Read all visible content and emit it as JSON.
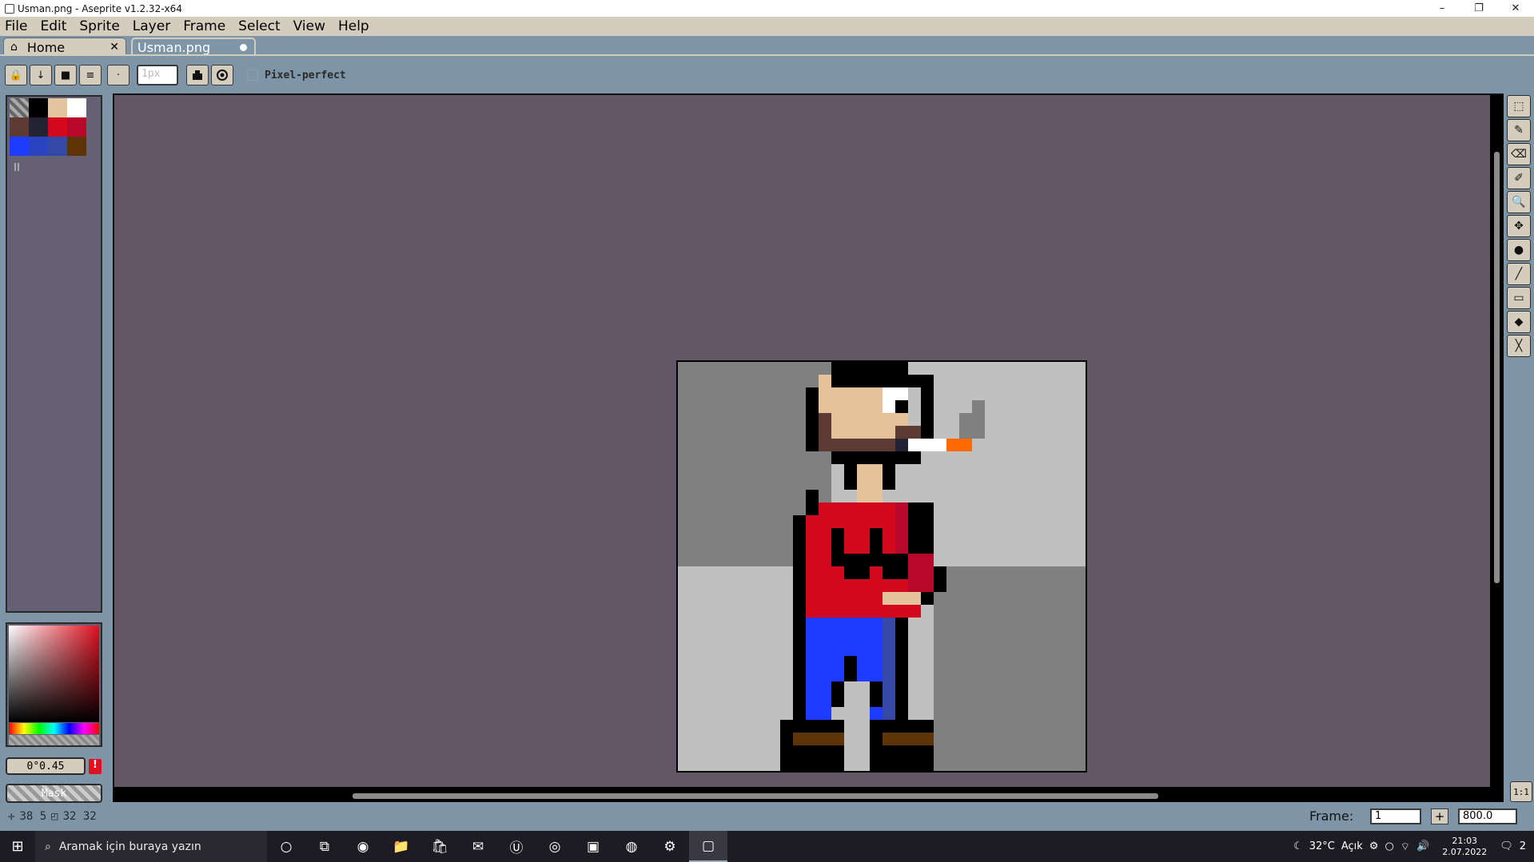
{
  "window": {
    "title": "Usman.png - Aseprite v1.2.32-x64",
    "controls": [
      "–",
      "❐",
      "✕"
    ]
  },
  "menu": [
    "File",
    "Edit",
    "Sprite",
    "Layer",
    "Frame",
    "Select",
    "View",
    "Help"
  ],
  "tabs": [
    {
      "label": "Home",
      "icon": "house-icon",
      "close": "✕"
    },
    {
      "label": "Usman.png",
      "modified": true
    }
  ],
  "toolbar": {
    "buttons": [
      "🔒",
      "↓",
      "■",
      "≡",
      "·"
    ],
    "brush_size": "1px",
    "pixel_perfect_label": "Pixel-perfect",
    "pixel_perfect_checked": false
  },
  "palette": [
    "transparent",
    "#000000",
    "#e2c4a0",
    "#ffffff",
    "#5e3a34",
    "#232334",
    "#d4081c",
    "#b8082a",
    "#1c3cff",
    "#2a44c0",
    "#3448a8",
    "#5c3408"
  ],
  "color_picker": {
    "value": "0°0.45",
    "mask_label": "Mask"
  },
  "status": {
    "cursor": "38 5",
    "size": "32 32"
  },
  "frame": {
    "label": "Frame:",
    "value": "1",
    "add": "+",
    "zoom": "800.0"
  },
  "tools": [
    "⬚",
    "✎",
    "⌫",
    "✐",
    "🔍",
    "✥",
    "●",
    "╱",
    "▭",
    "◆",
    "╳"
  ],
  "zoom_fit_label": "1:1",
  "taskbar": {
    "search_placeholder": "Aramak için buraya yazın",
    "weather": "32°C",
    "weather_label": "Açık",
    "time": "21:03",
    "date": "2.07.2022",
    "notifications": "2"
  }
}
